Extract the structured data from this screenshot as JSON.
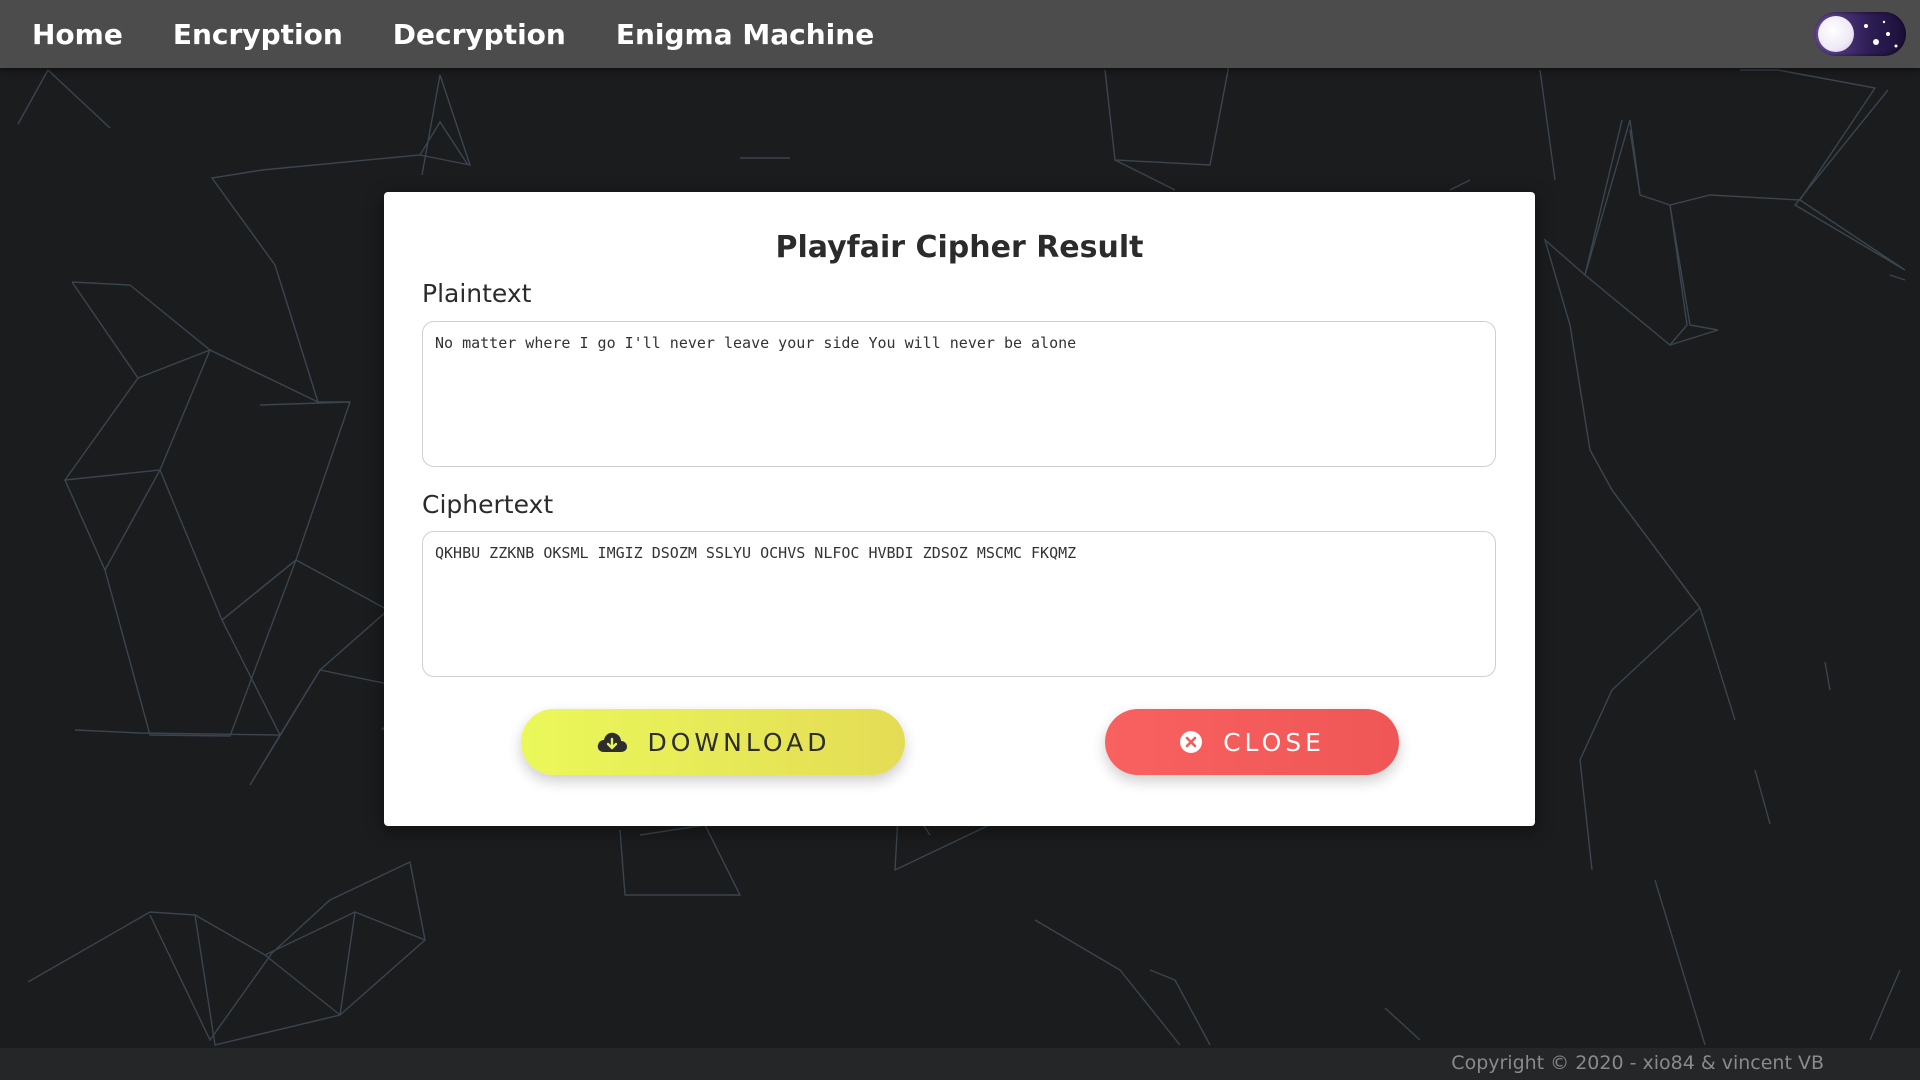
{
  "nav": {
    "items": [
      {
        "label": "Home"
      },
      {
        "label": "Encryption"
      },
      {
        "label": "Decryption"
      },
      {
        "label": "Enigma Machine"
      }
    ],
    "theme_toggle_icon": "moon-toggle-icon"
  },
  "modal": {
    "title": "Playfair Cipher Result",
    "plaintext_label": "Plaintext",
    "plaintext_value": "No matter where I go I'll never leave your side You will never be alone",
    "ciphertext_label": "Ciphertext",
    "ciphertext_value": "QKHBU ZZKNB OKSML IMGIZ DSOZM SSLYU OCHVS NLFOC HVBDI ZDSOZ MSCMC FKQMZ",
    "download_label": "DOWNLOAD",
    "download_icon": "cloud-download-icon",
    "close_label": "CLOSE",
    "close_icon": "x-circle-icon"
  },
  "footer": {
    "copyright": "Copyright © 2020 - xio84 & vincent VB"
  },
  "colors": {
    "navbar": "#4c4c4c",
    "background": "#1b1c1d",
    "download_button": "#e8f25a",
    "close_button": "#f45b5b"
  }
}
